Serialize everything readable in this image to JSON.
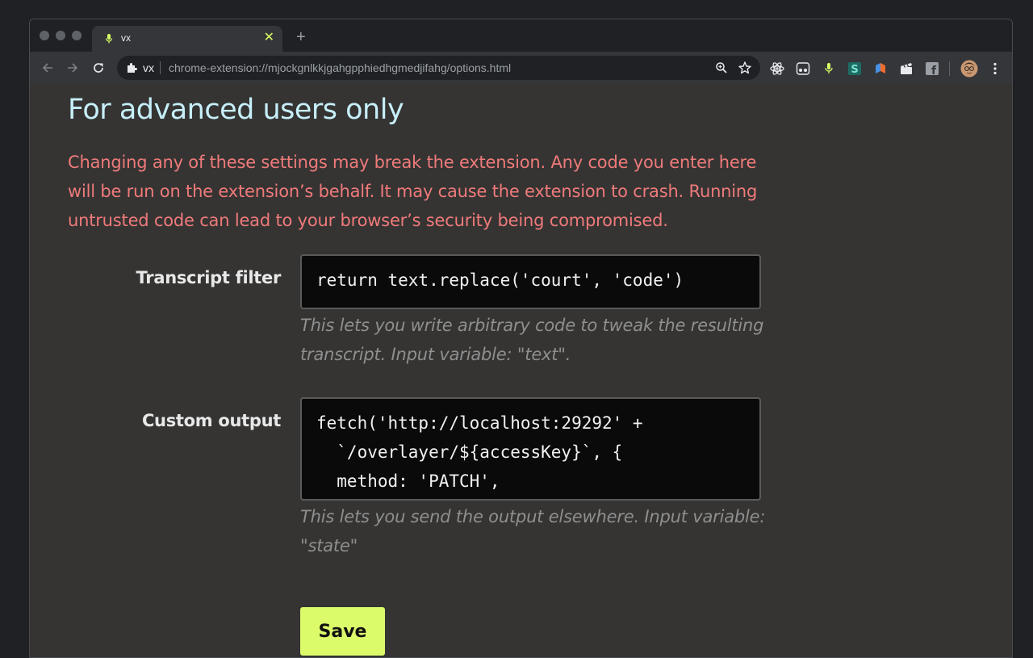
{
  "browser": {
    "tab": {
      "title": "vx",
      "favicon": "microphone-icon",
      "close_glyph": "✕"
    },
    "new_tab_glyph": "+",
    "omnibox": {
      "origin_label": "vx",
      "url": "chrome-extension://mjockgnlkkjgahgpphiedhgmedjifahg/options.html"
    },
    "extensions": [
      "react-devtools-icon",
      "dictation-icon",
      "mic-extension-icon",
      "stylus-icon",
      "pocket-icon",
      "clapper-icon",
      "facebook-icon"
    ],
    "colors": {
      "accent": "#d8fd63",
      "chrome_dark": "#202124",
      "toolbar": "#35363a"
    }
  },
  "page": {
    "heading": "For advanced users only",
    "warning": "Changing any of these settings may break the extension. Any code you enter here will be run on the extension’s behalf. It may cause the extension to crash. Running untrusted code can lead to your browser’s security being compromised.",
    "transcript_filter": {
      "label": "Transcript filter",
      "value": "return text.replace('court', 'code')",
      "help": "This lets you write arbitrary code to tweak the resulting transcript. Input variable: \"text\"."
    },
    "custom_output": {
      "label": "Custom output",
      "value": "fetch('http://localhost:29292' +\n  `/overlayer/${accessKey}`, {\n  method: 'PATCH',\n  headers: {",
      "help": "This lets you send the output elsewhere. Input variable: \"state\""
    },
    "save_label": "Save",
    "colors": {
      "heading": "#c7eff9",
      "warning": "#ef7a7a",
      "save_button": "#dcfb6a"
    }
  }
}
